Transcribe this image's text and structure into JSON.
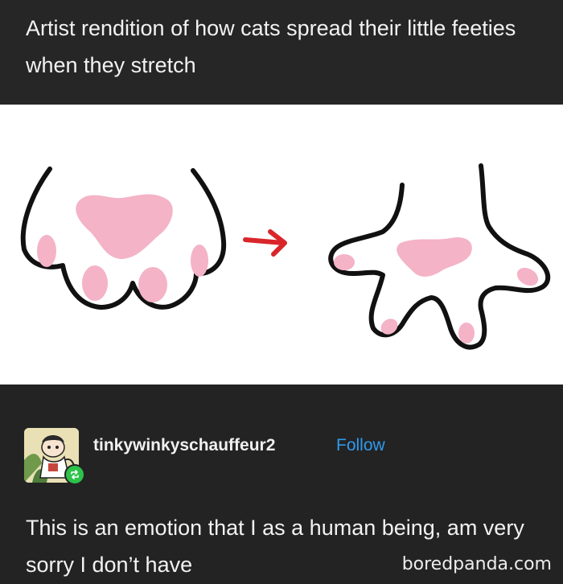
{
  "post": {
    "text": "Artist rendition of how cats spread their little feeties when they stretch"
  },
  "illustration": {
    "paw_pad_color": "#f4b3c7",
    "outline_color": "#111111",
    "arrow_color": "#d9262b"
  },
  "reblog": {
    "username": "tinkywinkyschauffeur2",
    "follow_label": "Follow",
    "text": "This is an emotion that I as a human being, am very sorry I don’t have",
    "badge_color": "#2dc24a",
    "follow_color": "#2e9bf0"
  },
  "watermark": "boredpanda.com"
}
